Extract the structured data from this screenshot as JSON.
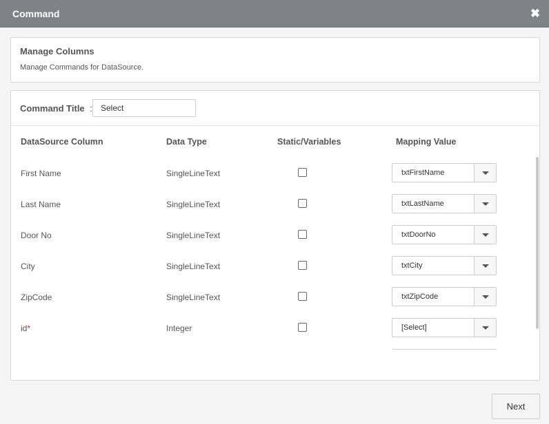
{
  "window": {
    "title": "Command",
    "close_icon": "close-icon"
  },
  "info": {
    "heading": "Manage Columns",
    "description": "Manage Commands for DataSource."
  },
  "command": {
    "label": "Command Title",
    "separator": ":",
    "value": "Select"
  },
  "table": {
    "headers": [
      "DataSource Column",
      "Data Type",
      "Static/Variables",
      "Mapping Value"
    ],
    "rows": [
      {
        "column": "First Name",
        "required": "",
        "data_type": "SingleLineText",
        "static": false,
        "mapping": "txtFirstName"
      },
      {
        "column": "Last Name",
        "required": "",
        "data_type": "SingleLineText",
        "static": false,
        "mapping": "txtLastName"
      },
      {
        "column": "Door No",
        "required": "",
        "data_type": "SingleLineText",
        "static": false,
        "mapping": "txtDoorNo"
      },
      {
        "column": "City",
        "required": "",
        "data_type": "SingleLineText",
        "static": false,
        "mapping": "txtCity"
      },
      {
        "column": "ZipCode",
        "required": "",
        "data_type": "SingleLineText",
        "static": false,
        "mapping": "txtZipCode"
      },
      {
        "column": "id",
        "required": "*",
        "data_type": "Integer",
        "static": false,
        "mapping": "[Select]"
      }
    ]
  },
  "footer": {
    "next_label": "Next"
  },
  "colors": {
    "titlebar": "#7d8389",
    "required": "#d9232a"
  }
}
